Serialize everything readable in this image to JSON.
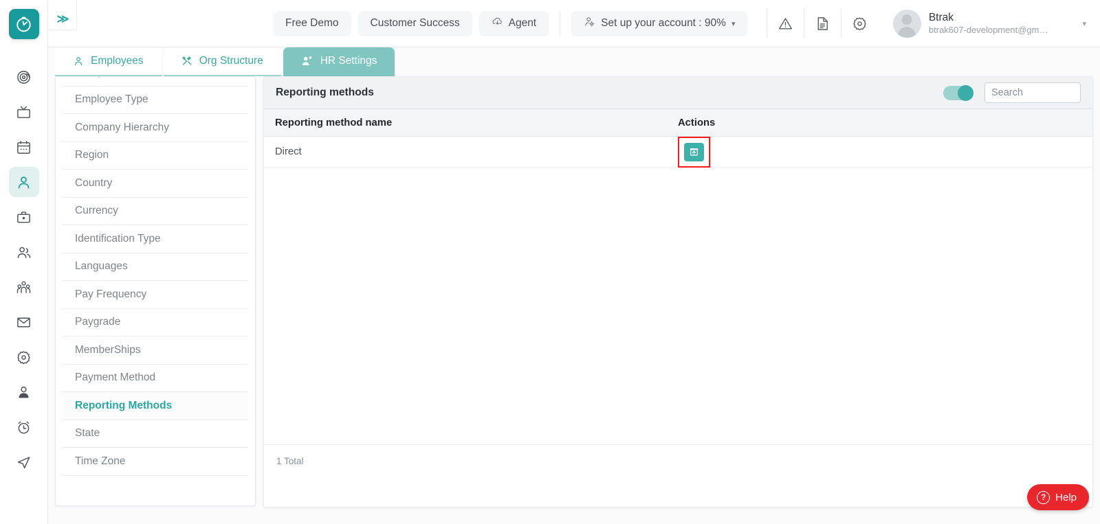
{
  "brand": {
    "accent": "#2aa7a2",
    "logo_icon": "clock-logo-icon",
    "tab_active_bg": "#81c5c1"
  },
  "rail": {
    "items": [
      {
        "name": "target-icon",
        "active": false
      },
      {
        "name": "tv-icon",
        "active": false
      },
      {
        "name": "calendar-icon",
        "active": false
      },
      {
        "name": "user-icon",
        "active": true
      },
      {
        "name": "briefcase-icon",
        "active": false
      },
      {
        "name": "users-pair-icon",
        "active": false
      },
      {
        "name": "team-group-icon",
        "active": false
      },
      {
        "name": "mail-icon",
        "active": false
      },
      {
        "name": "gear-icon",
        "active": false
      },
      {
        "name": "person-badge-icon",
        "active": false
      },
      {
        "name": "alarm-clock-icon",
        "active": false
      },
      {
        "name": "send-navigation-icon",
        "active": false
      }
    ]
  },
  "header": {
    "expand_label": "≫",
    "buttons": [
      {
        "label": "Free Demo",
        "icon": ""
      },
      {
        "label": "Customer Success",
        "icon": ""
      },
      {
        "label": "Agent",
        "icon": "cloud-download-icon"
      }
    ],
    "account_setup": {
      "label": "Set up your account : 90%",
      "icon": "user-gear-icon",
      "caret": "▾"
    },
    "icons": [
      {
        "name": "warning-triangle-icon"
      },
      {
        "name": "document-icon"
      },
      {
        "name": "gear-icon"
      }
    ],
    "user": {
      "name": "Btrak",
      "email": "btrak607-development@gm…",
      "caret": "▾"
    }
  },
  "tabs": [
    {
      "label": "Employees",
      "icon": "person-icon",
      "active": false
    },
    {
      "label": "Org Structure",
      "icon": "tools-icon",
      "active": false
    },
    {
      "label": "HR Settings",
      "icon": "people-settings-icon",
      "active": true
    }
  ],
  "sidebar": {
    "items": [
      {
        "label": "Designation",
        "active": false
      },
      {
        "label": "Employee Type",
        "active": false
      },
      {
        "label": "Company Hierarchy",
        "active": false
      },
      {
        "label": "Region",
        "active": false
      },
      {
        "label": "Country",
        "active": false
      },
      {
        "label": "Currency",
        "active": false
      },
      {
        "label": "Identification Type",
        "active": false
      },
      {
        "label": "Languages",
        "active": false
      },
      {
        "label": "Pay Frequency",
        "active": false
      },
      {
        "label": "Paygrade",
        "active": false
      },
      {
        "label": "MemberShips",
        "active": false
      },
      {
        "label": "Payment Method",
        "active": false
      },
      {
        "label": "Reporting Methods",
        "active": true
      },
      {
        "label": "State",
        "active": false
      },
      {
        "label": "Time Zone",
        "active": false
      }
    ]
  },
  "panel": {
    "title": "Reporting methods",
    "toggle_on": true,
    "search_placeholder": "Search",
    "search_value": "",
    "columns": {
      "name": "Reporting method name",
      "actions": "Actions"
    },
    "rows": [
      {
        "name": "Direct",
        "action_icon": "archive-upload-icon",
        "highlighted": true
      }
    ],
    "footer_total": "1 Total"
  },
  "help": {
    "label": "Help",
    "icon": "question-mark-icon",
    "color": "#e8262c"
  }
}
